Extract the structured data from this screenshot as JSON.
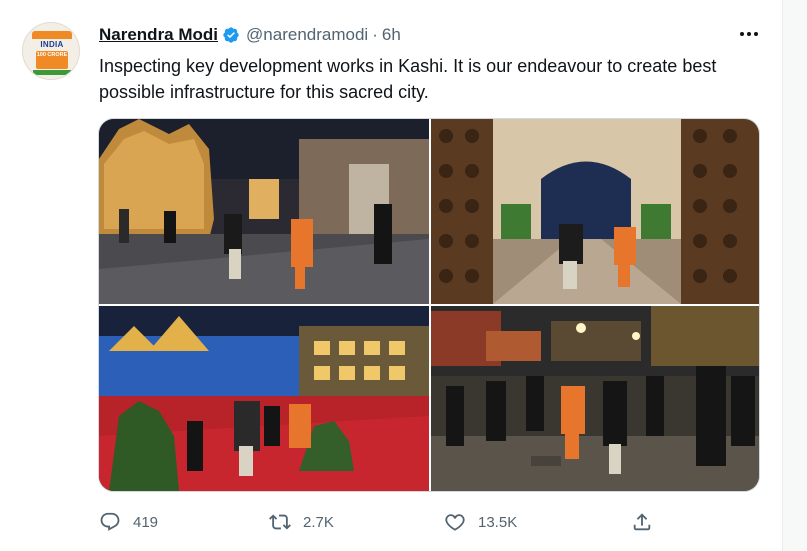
{
  "tweet": {
    "author_name": "Narendra Modi",
    "handle": "@narendramodi",
    "separator": "·",
    "time": "6h",
    "text": "Inspecting key development works in Kashi. It is our endeavour to create best possible infrastructure for this sacred city.",
    "avatar_text": {
      "line1": "INDIA",
      "line2": "100 CRORE"
    },
    "verified_color": "#1d9bf0"
  },
  "actions": {
    "reply": {
      "icon": "reply-icon",
      "count": "419"
    },
    "retweet": {
      "icon": "retweet-icon",
      "count": "2.7K"
    },
    "like": {
      "icon": "heart-icon",
      "count": "13.5K"
    },
    "share": {
      "icon": "share-icon"
    }
  },
  "colors": {
    "text": "#0f1419",
    "secondary": "#536471",
    "accent": "#1d9bf0",
    "saffron": "#f08a24"
  }
}
